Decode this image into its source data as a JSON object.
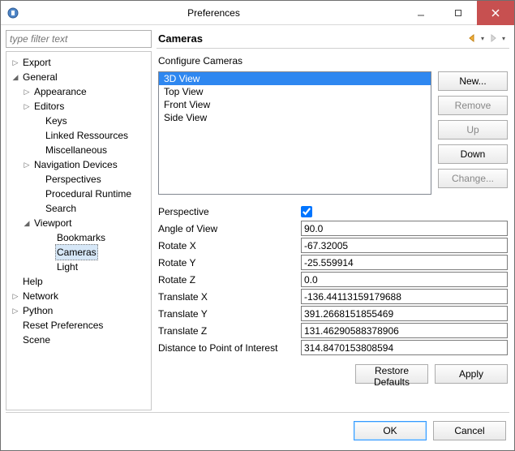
{
  "window": {
    "title": "Preferences"
  },
  "filter": {
    "placeholder": "type filter text"
  },
  "tree": {
    "export": "Export",
    "general": "General",
    "appearance": "Appearance",
    "editors": "Editors",
    "keys": "Keys",
    "linked": "Linked Ressources",
    "misc": "Miscellaneous",
    "navdev": "Navigation Devices",
    "perspectives": "Perspectives",
    "procrt": "Procedural Runtime",
    "search": "Search",
    "viewport": "Viewport",
    "bookmarks": "Bookmarks",
    "cameras": "Cameras",
    "light": "Light",
    "help": "Help",
    "network": "Network",
    "python": "Python",
    "resetp": "Reset Preferences",
    "scene": "Scene"
  },
  "page": {
    "heading": "Cameras",
    "subtitle": "Configure Cameras"
  },
  "cameras": {
    "items": [
      "3D View",
      "Top View",
      "Front View",
      "Side View"
    ],
    "selected_index": 0
  },
  "buttons": {
    "new": "New...",
    "remove": "Remove",
    "up": "Up",
    "down": "Down",
    "change": "Change...",
    "restore": "Restore Defaults",
    "apply": "Apply",
    "ok": "OK",
    "cancel": "Cancel"
  },
  "props": {
    "perspective_label": "Perspective",
    "perspective_checked": true,
    "angle_label": "Angle of View",
    "angle": "90.0",
    "rotx_label": "Rotate X",
    "rotx": "-67.32005",
    "roty_label": "Rotate Y",
    "roty": "-25.559914",
    "rotz_label": "Rotate Z",
    "rotz": "0.0",
    "tx_label": "Translate X",
    "tx": "-136.44113159179688",
    "ty_label": "Translate Y",
    "ty": "391.2668151855469",
    "tz_label": "Translate Z",
    "tz": "131.46290588378906",
    "dpoi_label": "Distance to Point of Interest",
    "dpoi": "314.8470153808594"
  }
}
